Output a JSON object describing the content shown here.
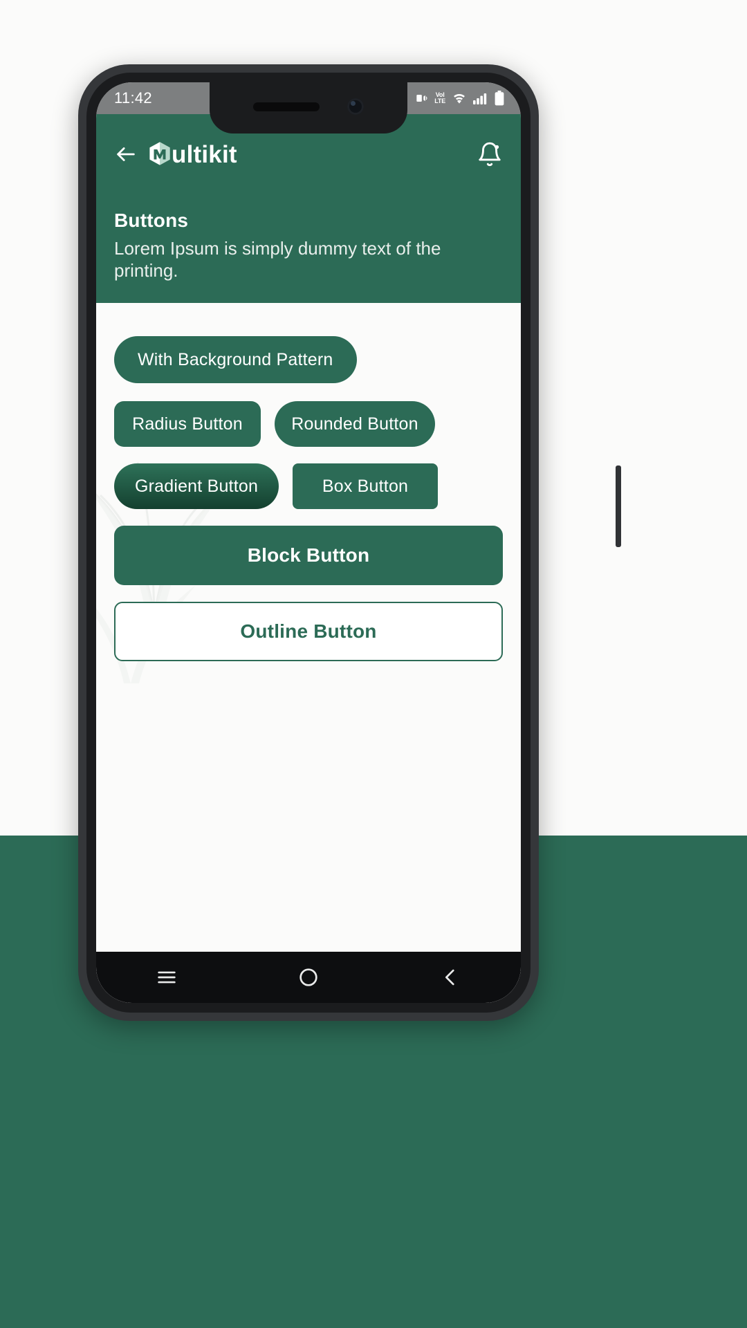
{
  "statusbar": {
    "time": "11:42",
    "icons": [
      "vibrate-icon",
      "volte-icon",
      "wifi-icon",
      "signal-icon",
      "battery-icon"
    ],
    "volte_top": "VoI",
    "volte_bottom": "LTE"
  },
  "header": {
    "back_icon": "back-arrow-icon",
    "brand_name": "ultikit",
    "brand_logo": "multikit-m-logo",
    "notification_icon": "bell-icon",
    "title": "Buttons",
    "description": " Lorem Ipsum is simply dummy text of the printing."
  },
  "buttons": {
    "with_background_pattern": "With Background Pattern",
    "radius": "Radius Button",
    "rounded": "Rounded Button",
    "gradient": "Gradient Button",
    "box": "Box Button",
    "block": "Block Button",
    "outline": "Outline Button"
  },
  "navbar": {
    "menu": "menu-icon",
    "home": "home-circle-icon",
    "back": "back-chevron-icon"
  },
  "colors": {
    "brand_green": "#2C6B56",
    "gradient_top": "#2E7259",
    "gradient_bottom": "#14402F",
    "screen_bg": "#FBFBFA",
    "statusbar_bg": "#7D7F80",
    "navbar_bg": "#0D0E10"
  }
}
